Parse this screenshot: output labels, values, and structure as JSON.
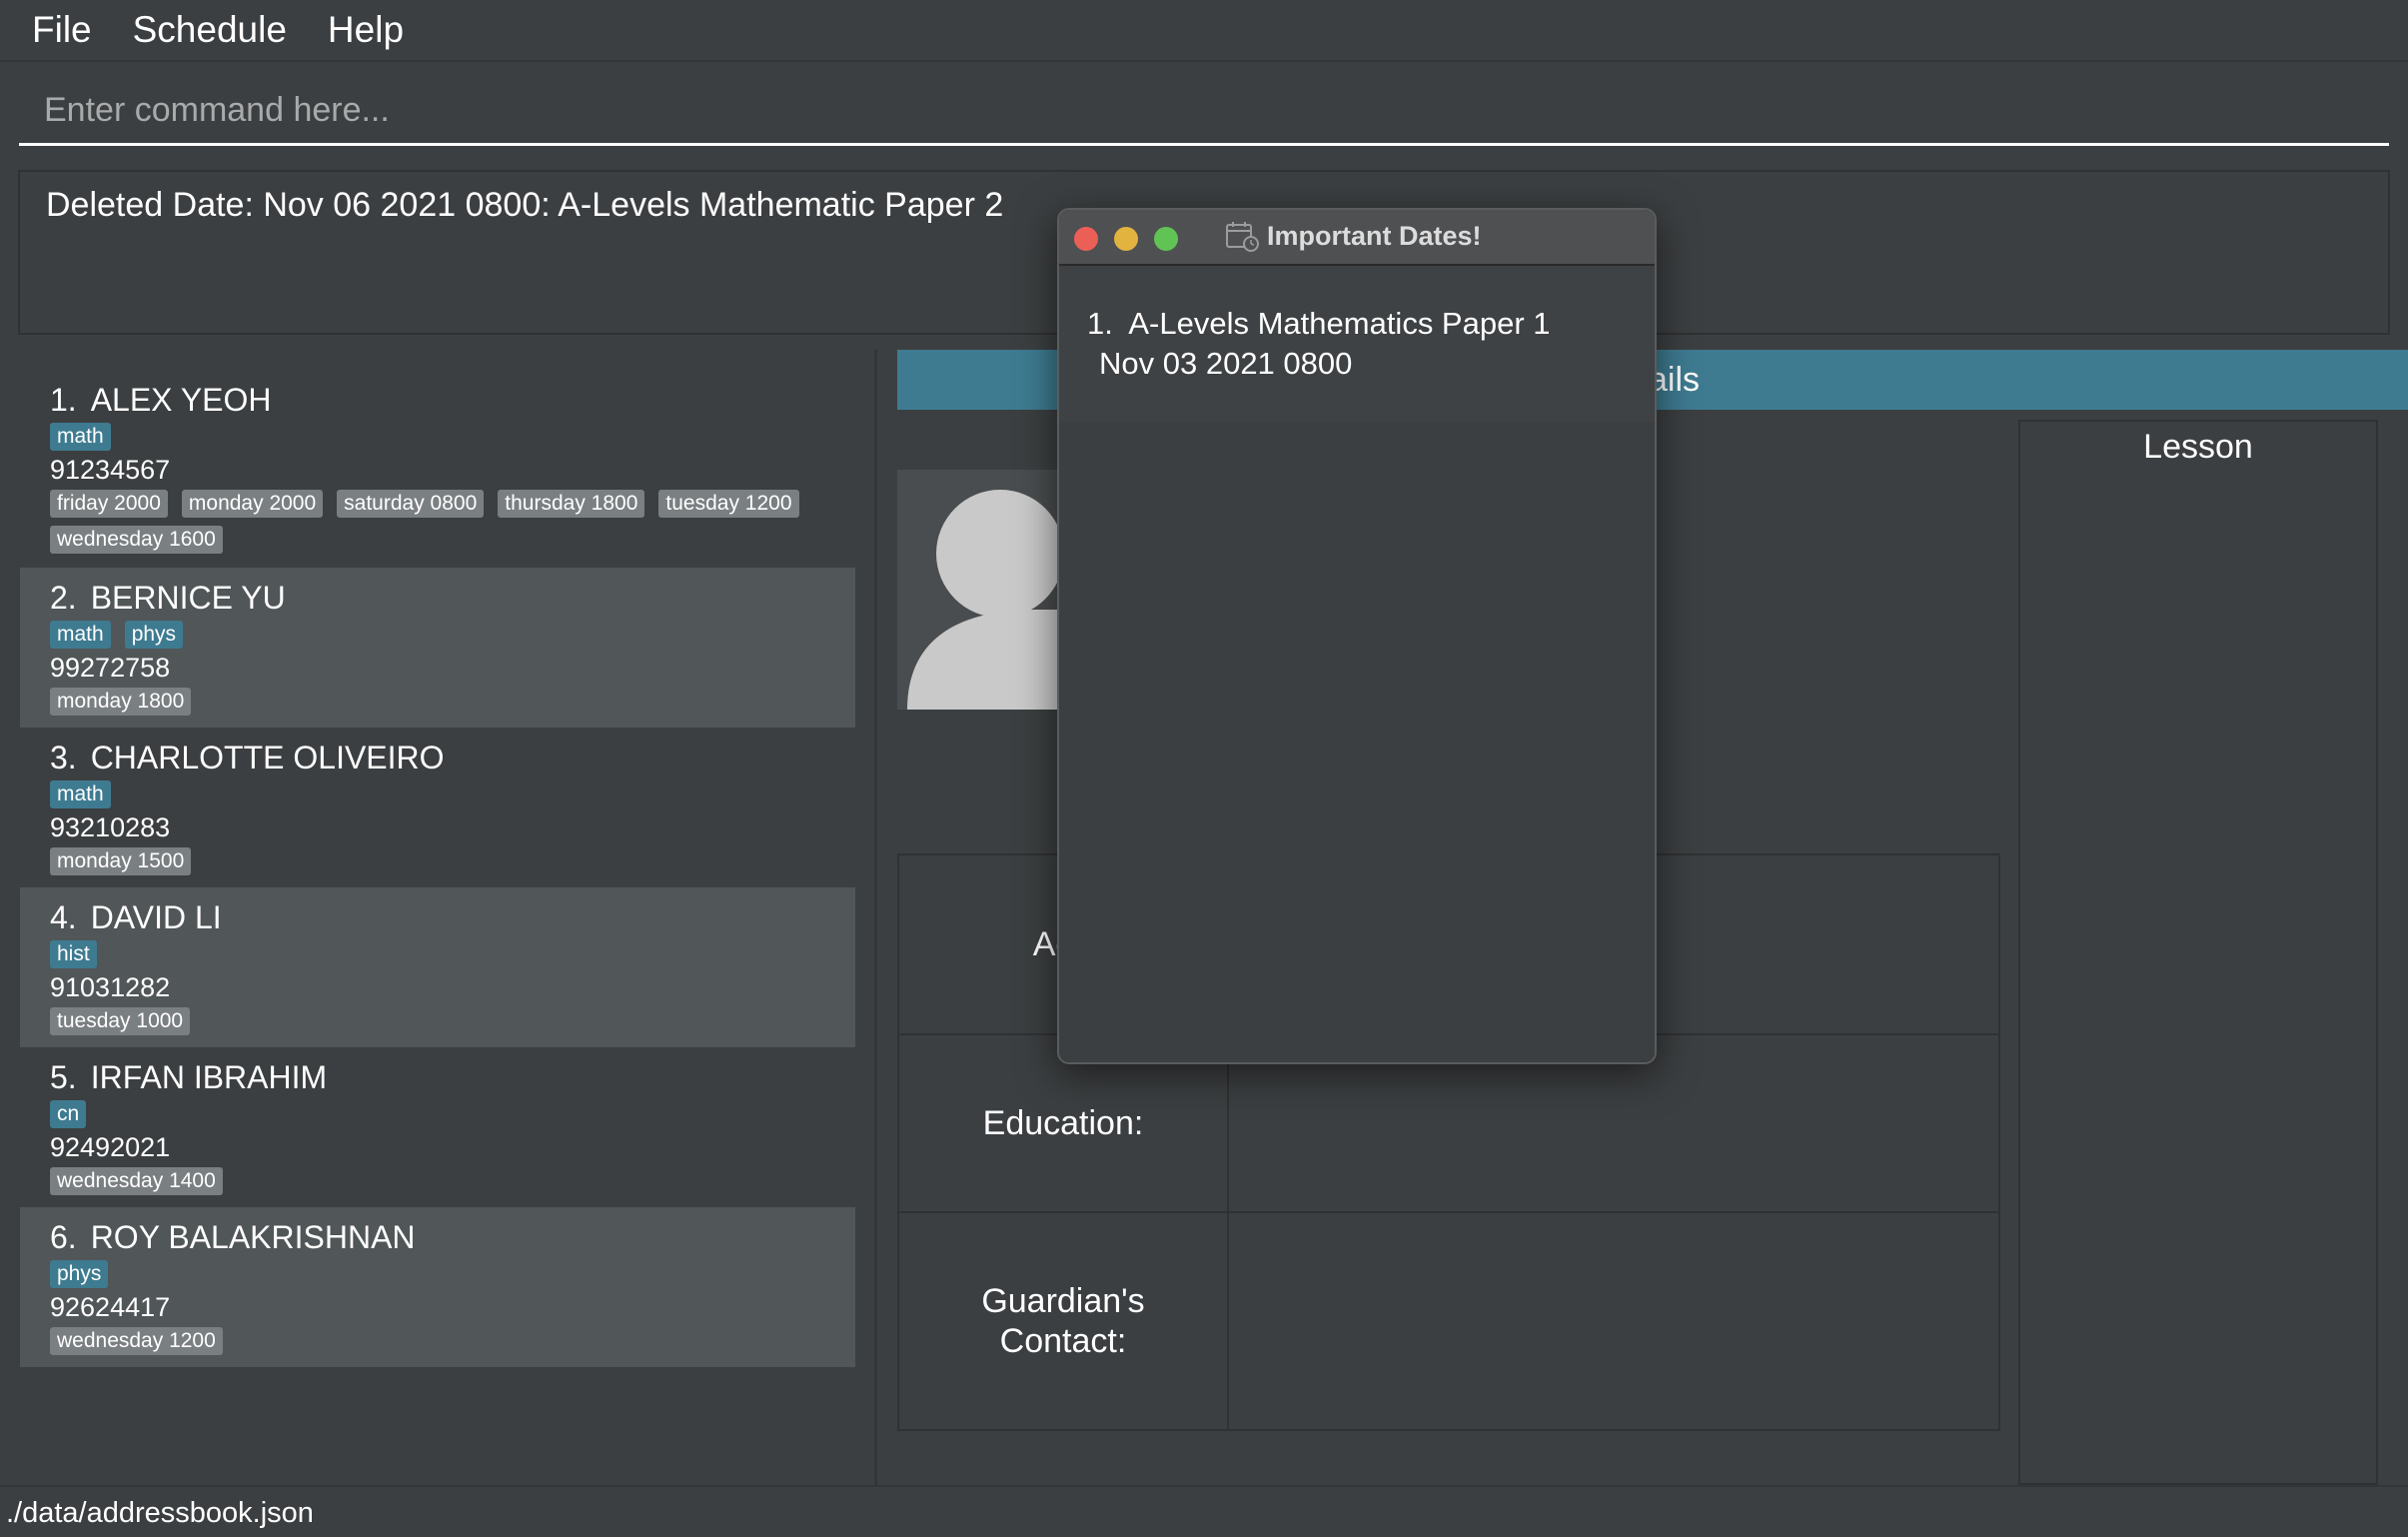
{
  "menu": {
    "file": "File",
    "schedule": "Schedule",
    "help": "Help"
  },
  "command": {
    "placeholder": "Enter command here..."
  },
  "result": {
    "text": "Deleted Date: Nov 06 2021 0800: A-Levels Mathematic Paper 2"
  },
  "persons": [
    {
      "index": "1.",
      "name": "ALEX YEOH",
      "tags": [
        "math"
      ],
      "phone": "91234567",
      "times": [
        "friday 2000",
        "monday 2000",
        "saturday 0800",
        "thursday 1800",
        "tuesday 1200",
        "wednesday 1600"
      ]
    },
    {
      "index": "2.",
      "name": "BERNICE YU",
      "tags": [
        "math",
        "phys"
      ],
      "phone": "99272758",
      "times": [
        "monday 1800"
      ]
    },
    {
      "index": "3.",
      "name": "CHARLOTTE OLIVEIRO",
      "tags": [
        "math"
      ],
      "phone": "93210283",
      "times": [
        "monday 1500"
      ]
    },
    {
      "index": "4.",
      "name": "DAVID LI",
      "tags": [
        "hist"
      ],
      "phone": "91031282",
      "times": [
        "tuesday 1000"
      ]
    },
    {
      "index": "5.",
      "name": "IRFAN IBRAHIM",
      "tags": [
        "cn"
      ],
      "phone": "92492021",
      "times": [
        "wednesday 1400"
      ]
    },
    {
      "index": "6.",
      "name": "ROY BALAKRISHNAN",
      "tags": [
        "phys"
      ],
      "phone": "92624417",
      "times": [
        "wednesday 1200"
      ]
    }
  ],
  "details": {
    "header_visible": "ails",
    "lesson_title": "Lesson",
    "labels": {
      "address": "Add",
      "education": "Education:",
      "guardian_line1": "Guardian's",
      "guardian_line2": "Contact:"
    }
  },
  "status": {
    "path": "./data/addressbook.json"
  },
  "popup": {
    "title": "Important Dates!",
    "dates": [
      {
        "index": "1.",
        "title": "A-Levels Mathematics Paper 1",
        "date": "Nov 03 2021 0800"
      }
    ]
  },
  "colors": {
    "accent": "#3e7b91",
    "background": "#3c3f41",
    "tag_time": "#7a7f82"
  },
  "icons": {
    "popup": "calendar-icon",
    "avatar": "user-silhouette-icon"
  }
}
